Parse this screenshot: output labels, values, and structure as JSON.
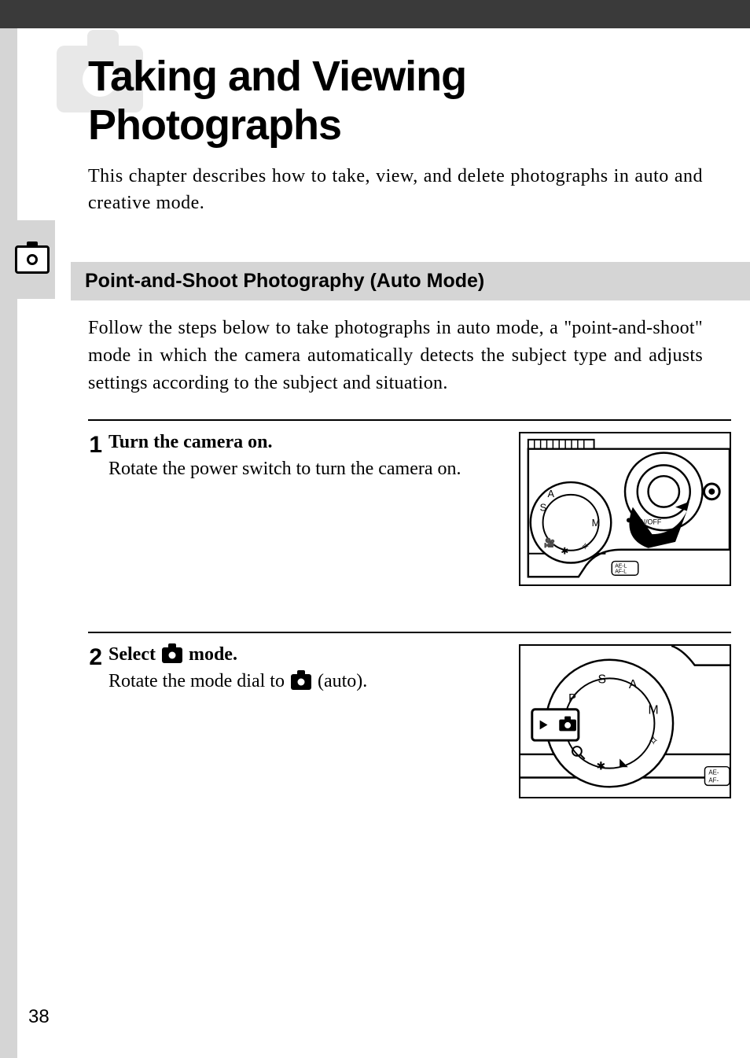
{
  "chapter": {
    "title": "Taking and Viewing Photographs",
    "intro": "This chapter describes how to take, view, and delete photographs in auto and creative mode."
  },
  "section": {
    "heading": "Point-and-Shoot Photography (Auto Mode)",
    "body": "Follow the steps below to take photographs in auto mode, a \"point-and-shoot\" mode in which the camera automatically detects the subject type and adjusts settings according to the subject and situation."
  },
  "steps": [
    {
      "number": "1",
      "title": "Turn the camera on.",
      "desc": "Rotate the power switch to turn the camera on."
    },
    {
      "number": "2",
      "title_pre": "Select ",
      "title_post": " mode.",
      "desc_pre": "Rotate the mode dial to ",
      "desc_post": " (auto)."
    }
  ],
  "page_number": "38",
  "icons": {
    "sidebar": "camera-icon",
    "inline": "camera-auto-icon"
  }
}
